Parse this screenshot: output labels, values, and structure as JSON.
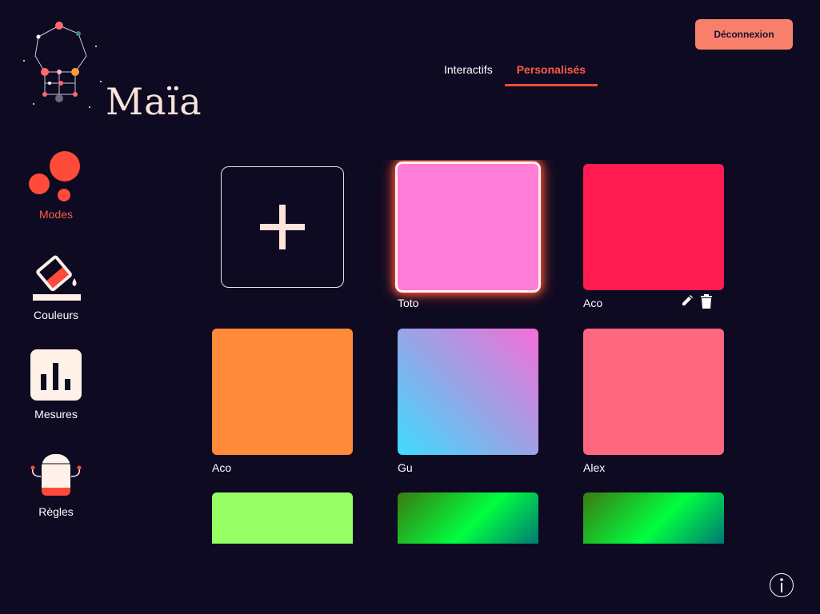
{
  "app": {
    "logo_text": "Maïa",
    "logout_label": "Déconnexion"
  },
  "tabs": [
    {
      "label": "Interactifs",
      "active": false
    },
    {
      "label": "Personalisés",
      "active": true
    }
  ],
  "sidebar": {
    "items": [
      {
        "label": "Modes",
        "icon": "modes-bubbles-icon",
        "active": true
      },
      {
        "label": "Couleurs",
        "icon": "paint-bucket-icon",
        "active": false
      },
      {
        "label": "Mesures",
        "icon": "bar-chart-icon",
        "active": false
      },
      {
        "label": "Règles",
        "icon": "robot-icon",
        "active": false
      }
    ]
  },
  "modes": [
    {
      "label": "Toto",
      "fill": "#ff7dd6",
      "selected": true
    },
    {
      "label": "Aco",
      "fill": "#ff1a52",
      "show_actions": true
    },
    {
      "label": "Aco",
      "fill": "#ff8a3a"
    },
    {
      "label": "Gu",
      "fill": "linear-gradient(45deg, #3ddcff 0%, #9aa3e6 50%, #f56ed8 100%)"
    },
    {
      "label": "Alex",
      "fill": "#ff6680"
    },
    {
      "label": "",
      "fill": "#95ff63"
    },
    {
      "label": "",
      "fill": "linear-gradient(135deg, #3a7a10 0%, #00ff40 40%, #008070 70%, #0020d0 100%)"
    },
    {
      "label": "",
      "fill": "linear-gradient(135deg, #3a7a10 0%, #00ff40 40%, #008070 70%, #0020d0 100%)"
    }
  ],
  "colors": {
    "background": "#0d0a22",
    "accent": "#ff5c43",
    "logout_button": "#f8806b"
  }
}
